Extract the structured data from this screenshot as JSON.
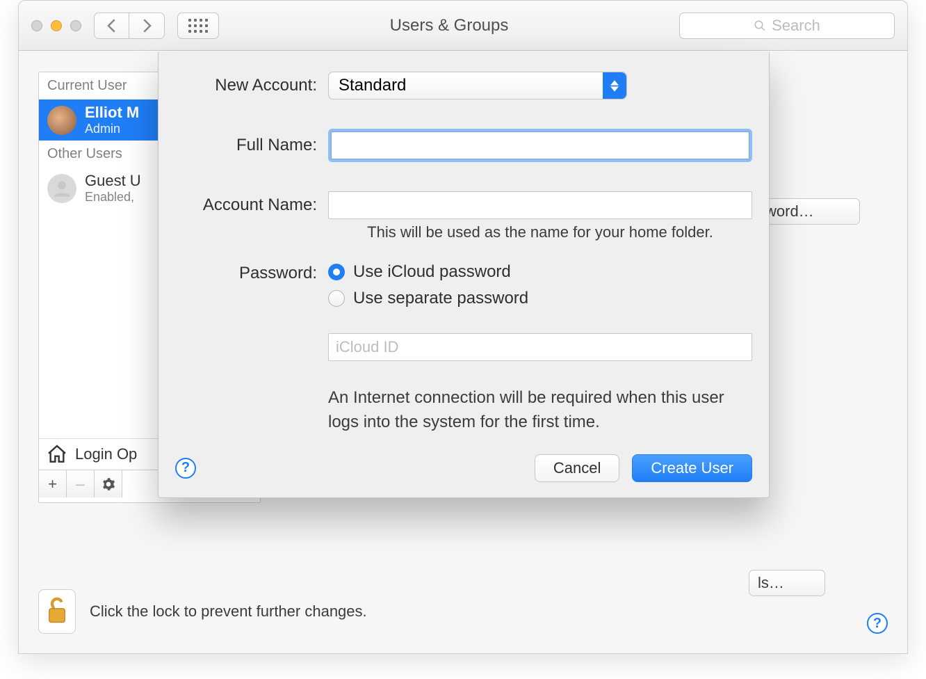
{
  "window": {
    "title": "Users & Groups",
    "search_placeholder": "Search"
  },
  "sidebar": {
    "sections": [
      {
        "caption": "Current User",
        "users": [
          {
            "name": "Elliot M",
            "role": "Admin"
          }
        ]
      },
      {
        "caption": "Other Users",
        "users": [
          {
            "name": "Guest U",
            "role": "Enabled,"
          }
        ]
      }
    ],
    "login_options": "Login Op",
    "footer": {
      "add": "+",
      "remove": "–",
      "gear": "✻"
    }
  },
  "background": {
    "password_button": "sword…",
    "ls_button": "ls…"
  },
  "lock_message": "Click the lock to prevent further changes.",
  "sheet": {
    "labels": {
      "new_account": "New Account:",
      "full_name": "Full Name:",
      "account_name": "Account Name:",
      "password": "Password:"
    },
    "new_account_value": "Standard",
    "full_name_value": "",
    "account_name_value": "",
    "account_name_hint": "This will be used as the name for your home folder.",
    "password_options": {
      "icloud": "Use iCloud password",
      "separate": "Use separate password",
      "selected": "icloud"
    },
    "icloud_id_placeholder": "iCloud ID",
    "internet_note": "An Internet connection will be required when this user logs into the system for the first time.",
    "buttons": {
      "cancel": "Cancel",
      "create": "Create User"
    }
  }
}
